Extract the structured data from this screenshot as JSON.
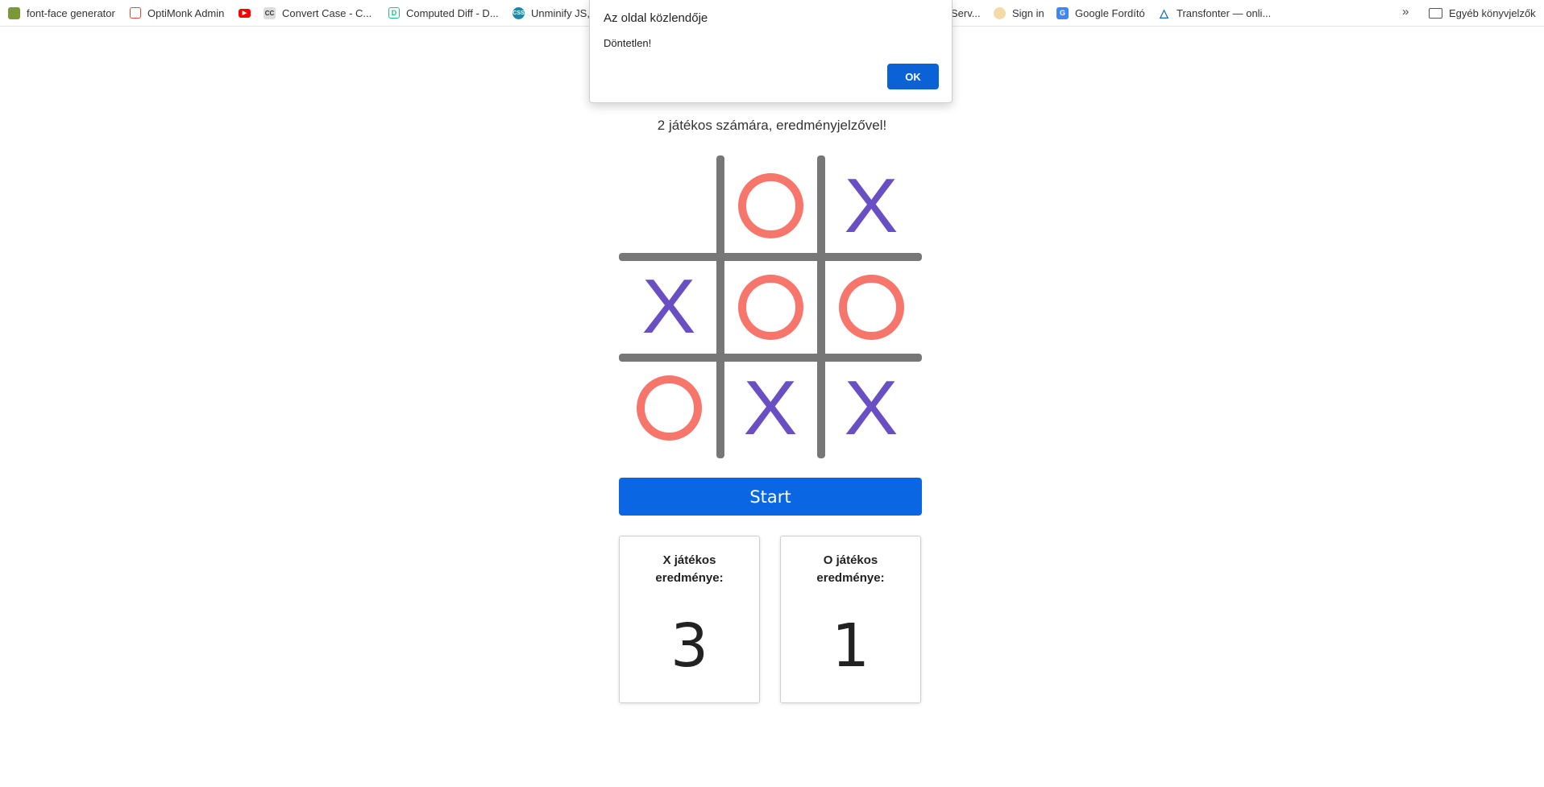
{
  "bookmarks": [
    {
      "label": "font-face generator",
      "icon": "font-face-generator-icon",
      "color": "#7a9a3a"
    },
    {
      "label": "OptiMonk Admin",
      "icon": "optimonk-icon",
      "color": "#e0463c"
    },
    {
      "label": "",
      "icon": "youtube-icon",
      "color": "#ff0000"
    },
    {
      "label": "Convert Case - C...",
      "icon": "convert-case-icon",
      "color": "#888888"
    },
    {
      "label": "Computed Diff - D...",
      "icon": "computed-diff-icon",
      "color": "#19c08a"
    },
    {
      "label": "Unminify JS,",
      "icon": "unminify-icon",
      "color": "#1a8aa8"
    },
    {
      "label": "Serv...",
      "icon": "",
      "color": ""
    },
    {
      "label": "Sign in",
      "icon": "sign-in-avatar-icon",
      "color": "#f1a54a"
    },
    {
      "label": "Google Fordító",
      "icon": "google-translate-icon",
      "color": "#4285f4"
    },
    {
      "label": "Transfonter — onli...",
      "icon": "transfonter-icon",
      "color": "#1a73b8"
    },
    {
      "label": "Egyéb könyvjelzők",
      "icon": "folder-icon",
      "color": "#555555"
    }
  ],
  "more_label": "»",
  "dialog": {
    "title": "Az oldal közlendője",
    "message": "Döntetlen!",
    "ok_label": "OK"
  },
  "subtitle": "2 játékos számára, eredményjelzővel!",
  "board": [
    [
      "",
      "O",
      "X"
    ],
    [
      "X",
      "O",
      "O"
    ],
    [
      "O",
      "X",
      "X"
    ]
  ],
  "start_label": "Start",
  "scores": {
    "x": {
      "label": "X játékos eredménye:",
      "value": "3"
    },
    "o": {
      "label": "O játékos eredménye:",
      "value": "1"
    }
  },
  "colors": {
    "x": "#6a4fc4",
    "o": "#f7766c",
    "grid": "#777777",
    "button": "#0b66e4"
  }
}
